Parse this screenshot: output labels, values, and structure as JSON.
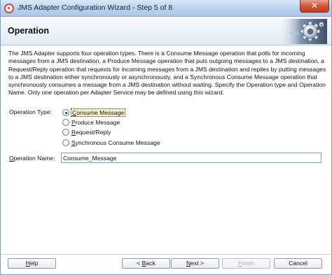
{
  "window": {
    "title": "JMS Adapter Configuration Wizard - Step 5 of 8",
    "close_glyph": "✕",
    "icon": "jms-adapter-icon"
  },
  "header": {
    "title": "Operation",
    "icon": "gear-icon"
  },
  "description": "The JMS Adapter supports four operation types.  There is a Consume Message operation that polls for incoming messages from a JMS destination, a Produce Message operation that puts outgoing messages to a JMS destination, a Request/Reply operation that requests for incoming messages from a JMS destination and replies by putting messages to a JMS destination either synchronously or asynchronously, and a Synchronous Consume Message operation that synchronously consumes a message from a JMS destination without waiting.  Specify the Operation type and Operation Name.  Only one operation per Adapter Service may be defined using this wizard.",
  "operation_type": {
    "label": "Operation Type:",
    "selected": "Consume Message",
    "options": [
      {
        "mnemonic": "C",
        "rest": "onsume Message",
        "checked": true
      },
      {
        "mnemonic": "P",
        "rest": "roduce Message",
        "checked": false
      },
      {
        "mnemonic": "R",
        "rest": "equest/Reply",
        "checked": false
      },
      {
        "mnemonic": "S",
        "rest": "ynchronous Consume Message",
        "checked": false
      }
    ]
  },
  "operation_name": {
    "label_mnemonic": "O",
    "label_rest": "peration Name:",
    "value": "Consume_Message"
  },
  "footer": {
    "help": {
      "mnemonic": "H",
      "rest": "elp"
    },
    "back": {
      "prefix": "< ",
      "mnemonic": "B",
      "rest": "ack"
    },
    "next": {
      "mnemonic": "N",
      "rest": "ext >"
    },
    "finish": {
      "mnemonic": "F",
      "rest": "inish"
    },
    "cancel": "Cancel"
  }
}
